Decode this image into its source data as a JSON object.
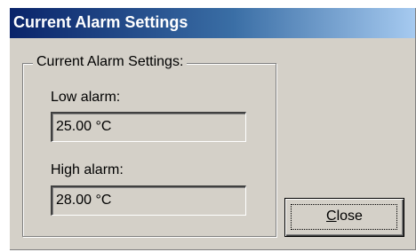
{
  "window": {
    "title": "Current Alarm Settings"
  },
  "group": {
    "legend": "Current Alarm Settings:"
  },
  "low_alarm": {
    "label": "Low alarm:",
    "value": "25.00 °C"
  },
  "high_alarm": {
    "label": "High alarm:",
    "value": "28.00 °C"
  },
  "close_button": {
    "mnemonic": "C",
    "label_rest": "lose"
  },
  "colors": {
    "titlebar_start": "#0a246a",
    "titlebar_end": "#a6caf0",
    "dialog_face": "#d4d0c8"
  }
}
